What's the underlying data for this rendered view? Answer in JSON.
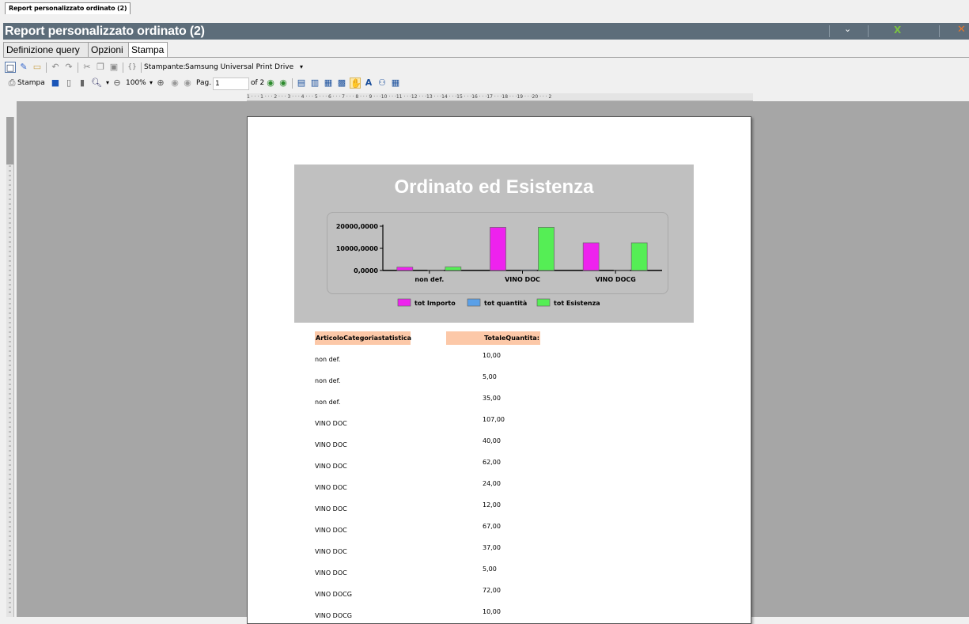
{
  "window": {
    "tab_label": "Report personalizzato ordinato (2)",
    "title": "Report personalizzato ordinato (2)",
    "icons": [
      "chevron-down-icon",
      "excel-icon",
      "close-icon"
    ]
  },
  "tabs": [
    {
      "label": "Definizione query",
      "active": false
    },
    {
      "label": "Opzioni",
      "active": false
    },
    {
      "label": "Stampa",
      "active": true
    }
  ],
  "toolbar1": {
    "printer_label": "Stampante:",
    "printer_value": "Samsung Universal Print Drive"
  },
  "toolbar2": {
    "print_label": "Stampa",
    "zoom_value": "100%",
    "page_label": "Pag.",
    "page_value": "1",
    "page_of": "of 2"
  },
  "ruler_text": "1 · · · 1 · · · 2 · · · 3 · · · 4 · · · 5 · · · 6 · · · 7 · · · 8 · · · 9 · · ·10 · · ·11 · · ·12 · · ·13 · · ·14 · · ·15 · · ·16 · · ·17 · · ·18 · · ·19 · · ·20 · · · 2",
  "chart_data": {
    "type": "bar",
    "title": "Ordinato ed Esistenza",
    "categories": [
      "non def.",
      "VINO DOC",
      "VINO DOCG"
    ],
    "series": [
      {
        "name": "tot Importo",
        "color": "#ee22ee",
        "values": [
          1500,
          19500,
          12500
        ]
      },
      {
        "name": "tot quantità",
        "color": "#5aa0e8",
        "values": [
          50,
          300,
          90
        ]
      },
      {
        "name": "tot Esistenza",
        "color": "#55ee55",
        "values": [
          1600,
          19500,
          12500
        ]
      }
    ],
    "ytick_labels": [
      "20000,0000",
      "10000,0000",
      "0,0000"
    ],
    "ylim": [
      0,
      20000
    ],
    "legend": "bottom"
  },
  "table": {
    "headers": [
      "ArticoloCategoriastatistica",
      "TotaleQuantita:"
    ],
    "rows": [
      [
        "non def.",
        "10,00"
      ],
      [
        "non def.",
        "5,00"
      ],
      [
        "non def.",
        "35,00"
      ],
      [
        "VINO DOC",
        "107,00"
      ],
      [
        "VINO DOC",
        "40,00"
      ],
      [
        "VINO DOC",
        "62,00"
      ],
      [
        "VINO DOC",
        "24,00"
      ],
      [
        "VINO DOC",
        "12,00"
      ],
      [
        "VINO DOC",
        "67,00"
      ],
      [
        "VINO DOC",
        "37,00"
      ],
      [
        "VINO DOC",
        "5,00"
      ],
      [
        "VINO DOCG",
        "72,00"
      ],
      [
        "VINO DOCG",
        "10,00"
      ]
    ]
  }
}
